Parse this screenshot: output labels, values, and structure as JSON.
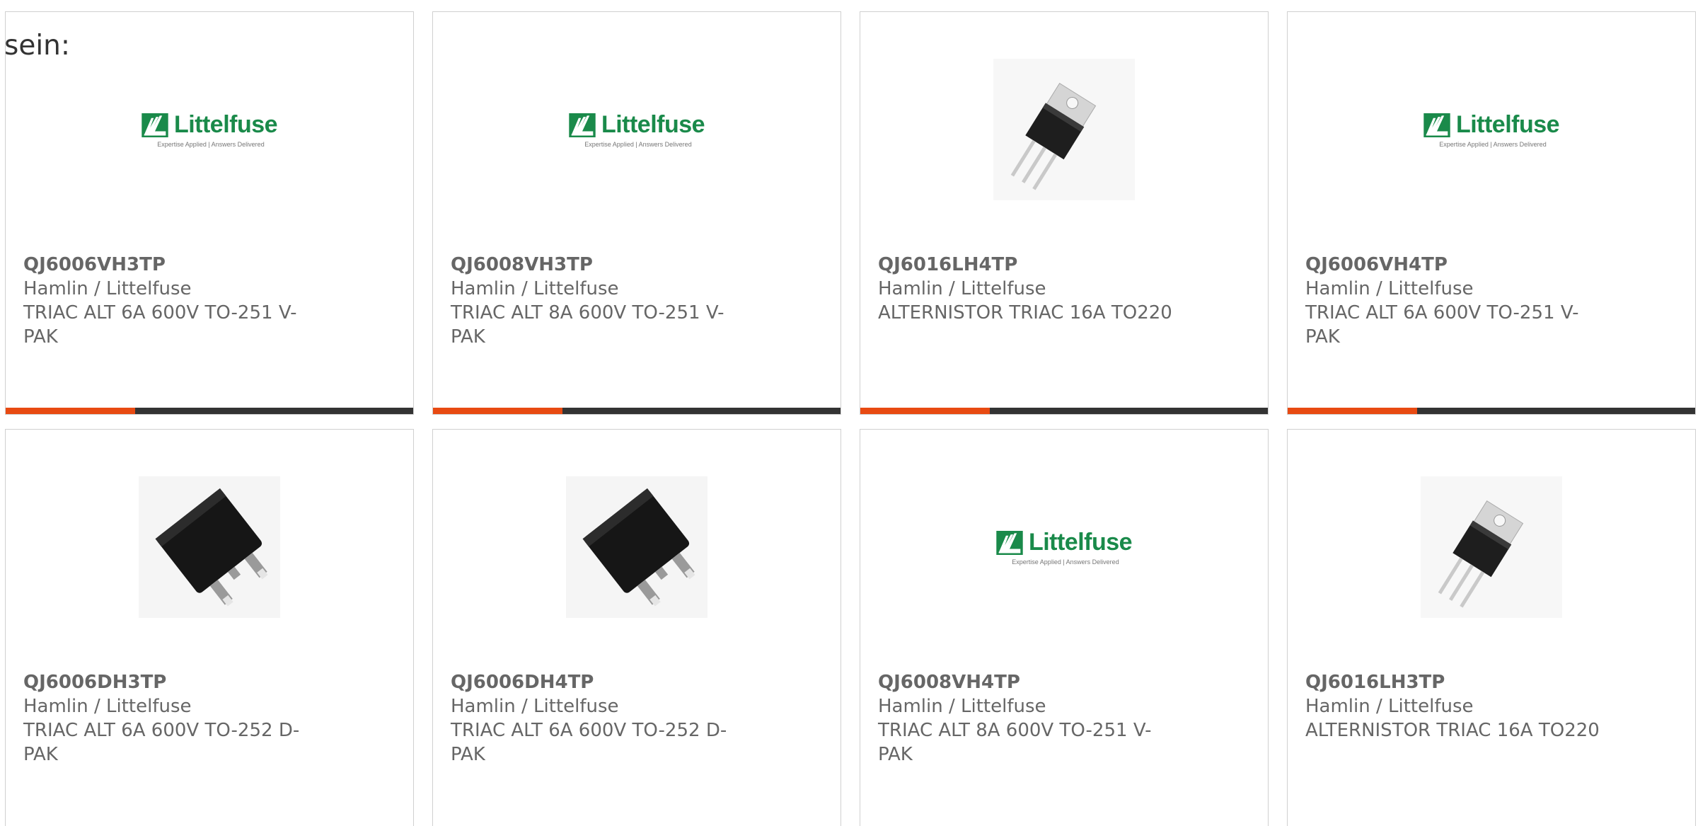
{
  "intro_text": "sein:",
  "colors": {
    "accent": "#e84a12",
    "bar": "#333333",
    "brand_green": "#1a8a4a",
    "text": "#666666"
  },
  "products": [
    {
      "part_number": "QJ6006VH3TP",
      "manufacturer": "Hamlin / Littelfuse",
      "description_line1": "TRIAC ALT 6A 600V TO-251 V-",
      "description_line2": "PAK",
      "image": "littelfuse-logo",
      "logo_text": "Littelfuse",
      "logo_tagline": "Expertise Applied | Answers Delivered"
    },
    {
      "part_number": "QJ6008VH3TP",
      "manufacturer": "Hamlin / Littelfuse",
      "description_line1": "TRIAC ALT 8A 600V TO-251 V-",
      "description_line2": "PAK",
      "image": "littelfuse-logo",
      "logo_text": "Littelfuse",
      "logo_tagline": "Expertise Applied | Answers Delivered"
    },
    {
      "part_number": "QJ6016LH4TP",
      "manufacturer": "Hamlin / Littelfuse",
      "description_line1": "ALTERNISTOR TRIAC 16A TO220",
      "description_line2": "",
      "image": "to220-package"
    },
    {
      "part_number": "QJ6006VH4TP",
      "manufacturer": "Hamlin / Littelfuse",
      "description_line1": "TRIAC ALT 6A 600V TO-251 V-",
      "description_line2": "PAK",
      "image": "littelfuse-logo",
      "logo_text": "Littelfuse",
      "logo_tagline": "Expertise Applied | Answers Delivered"
    },
    {
      "part_number": "QJ6006DH3TP",
      "manufacturer": "Hamlin / Littelfuse",
      "description_line1": "TRIAC ALT 6A 600V TO-252 D-",
      "description_line2": "PAK",
      "image": "dpak-package"
    },
    {
      "part_number": "QJ6006DH4TP",
      "manufacturer": "Hamlin / Littelfuse",
      "description_line1": "TRIAC ALT 6A 600V TO-252 D-",
      "description_line2": "PAK",
      "image": "dpak-package"
    },
    {
      "part_number": "QJ6008VH4TP",
      "manufacturer": "Hamlin / Littelfuse",
      "description_line1": "TRIAC ALT 8A 600V TO-251 V-",
      "description_line2": "PAK",
      "image": "littelfuse-logo",
      "logo_text": "Littelfuse",
      "logo_tagline": "Expertise Applied | Answers Delivered"
    },
    {
      "part_number": "QJ6016LH3TP",
      "manufacturer": "Hamlin / Littelfuse",
      "description_line1": "ALTERNISTOR TRIAC 16A TO220",
      "description_line2": "",
      "image": "to220-package"
    }
  ]
}
